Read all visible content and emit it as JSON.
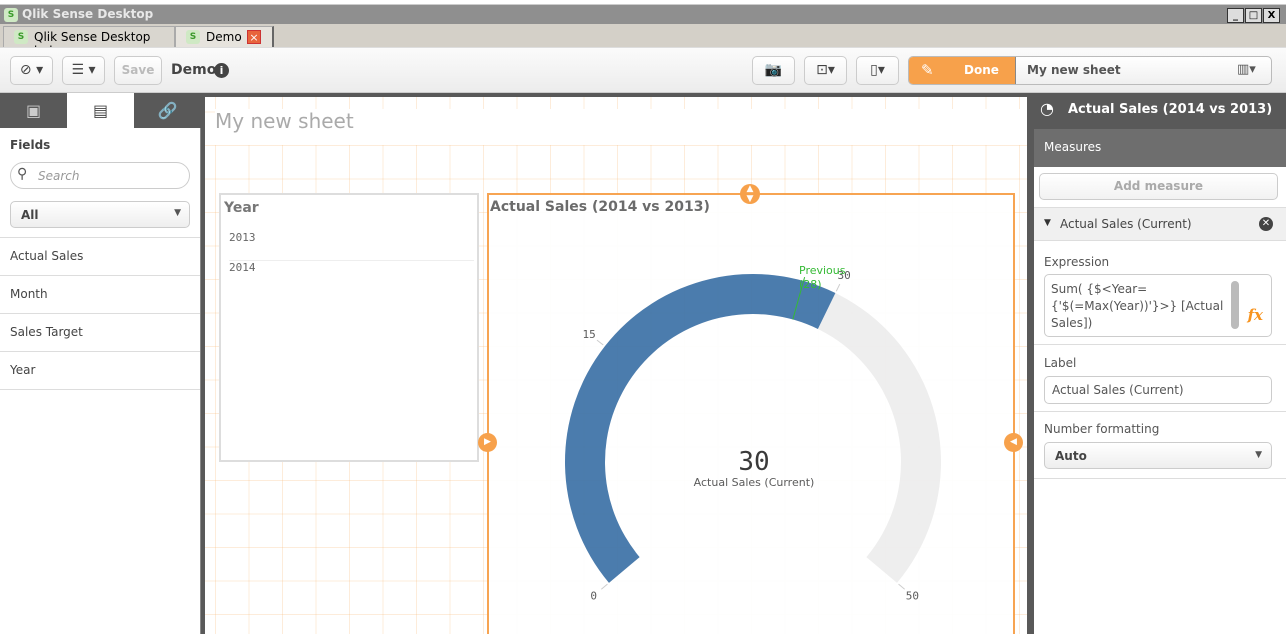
{
  "window": {
    "title": "Qlik Sense Desktop",
    "minimize": "_",
    "maximize": "□",
    "close": "X"
  },
  "tabs": [
    {
      "label": "Qlik Sense Desktop hub"
    },
    {
      "label": "Demo",
      "close": "×"
    }
  ],
  "toolbar": {
    "save_label": "Save",
    "app_name": "Demo",
    "done_label": "Done",
    "sheet_name": "My new sheet"
  },
  "left": {
    "fields_title": "Fields",
    "search_placeholder": "Search",
    "filter_value": "All",
    "fields": [
      "Actual Sales",
      "Month",
      "Sales Target",
      "Year"
    ]
  },
  "sheet": {
    "title": "My new sheet"
  },
  "filter_pane": {
    "title": "Year",
    "values": [
      "2013",
      "2014"
    ]
  },
  "gauge": {
    "title": "Actual Sales (2014 vs 2013)",
    "value_text": "30",
    "measure_label": "Actual Sales (Current)",
    "marker_label": "Previous",
    "marker_value_text": "(28)",
    "tick_labels": [
      "0",
      "15",
      "30",
      "50"
    ],
    "chart_data": {
      "type": "gauge",
      "min": 0,
      "max": 50,
      "value": 30,
      "marker": 28,
      "ticks": [
        0,
        15,
        30,
        50
      ],
      "value_color": "#4477aa",
      "track_color": "#eeeeee",
      "marker_color": "#2db82d"
    }
  },
  "right": {
    "title": "Actual Sales (2014 vs 2013)",
    "measures_title": "Measures",
    "add_measure": "Add measure",
    "measure_name": "Actual Sales (Current)",
    "expression_label": "Expression",
    "expression": "Sum( {$<Year={'$(=Max(Year))'}>} [Actual Sales])",
    "fx": "fx",
    "label_label": "Label",
    "label_value": "Actual Sales  (Current)",
    "number_formatting_label": "Number formatting",
    "number_formatting_value": "Auto"
  },
  "colors": {
    "accent": "#f7a14b",
    "dark": "#595959"
  }
}
